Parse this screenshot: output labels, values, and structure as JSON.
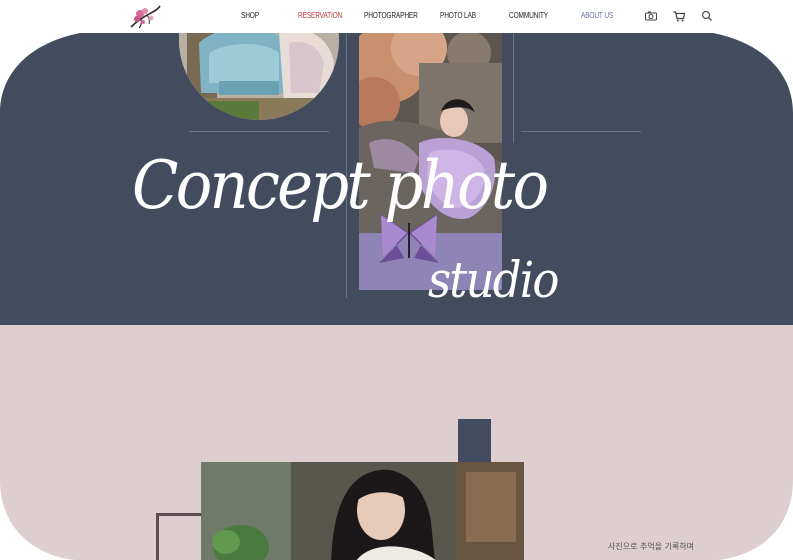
{
  "nav": {
    "items": [
      {
        "label": "SHOP",
        "state": "normal"
      },
      {
        "label": "RESERVATION",
        "state": "active"
      },
      {
        "label": "PHOTOGRAPHER",
        "state": "normal"
      },
      {
        "label": "PHOTO LAB",
        "state": "normal"
      },
      {
        "label": "COMMUNITY",
        "state": "normal"
      },
      {
        "label": "ABOUT US",
        "state": "muted"
      }
    ],
    "icons": [
      "camera-icon",
      "cart-icon",
      "search-icon"
    ]
  },
  "hero": {
    "title_line1": "Concept photo",
    "title_line2": "studio"
  },
  "section2": {
    "caption": "사진으로 추억을 기록하며"
  },
  "colors": {
    "hero_bg": "#434b5f",
    "section2_bg": "#ddcfd0",
    "nav_active": "#b23a3a",
    "nav_muted": "#6a73a6"
  }
}
